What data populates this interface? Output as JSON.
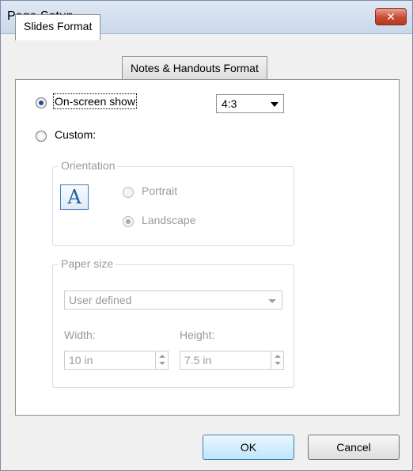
{
  "window": {
    "title": "Page Setup",
    "close_glyph": "✕"
  },
  "tabs": [
    {
      "label": "Slides Format",
      "active": true
    },
    {
      "label": "Notes & Handouts Format",
      "active": false
    }
  ],
  "options": {
    "on_screen": {
      "label": "On-screen show",
      "checked": true
    },
    "custom": {
      "label": "Custom:",
      "checked": false
    }
  },
  "ratio": {
    "value": "4:3"
  },
  "orientation": {
    "title": "Orientation",
    "icon_letter": "A",
    "portrait": {
      "label": "Portrait",
      "checked": false
    },
    "landscape": {
      "label": "Landscape",
      "checked": true
    }
  },
  "paper_size": {
    "title": "Paper size",
    "selected": "User defined",
    "width_label": "Width:",
    "width_value": "10 in",
    "height_label": "Height:",
    "height_value": "7.5 in"
  },
  "buttons": {
    "ok": "OK",
    "cancel": "Cancel"
  },
  "colors": {
    "accent": "#1a4f9c",
    "close_red": "#c94a34",
    "disabled_text": "#9a9a9a"
  }
}
